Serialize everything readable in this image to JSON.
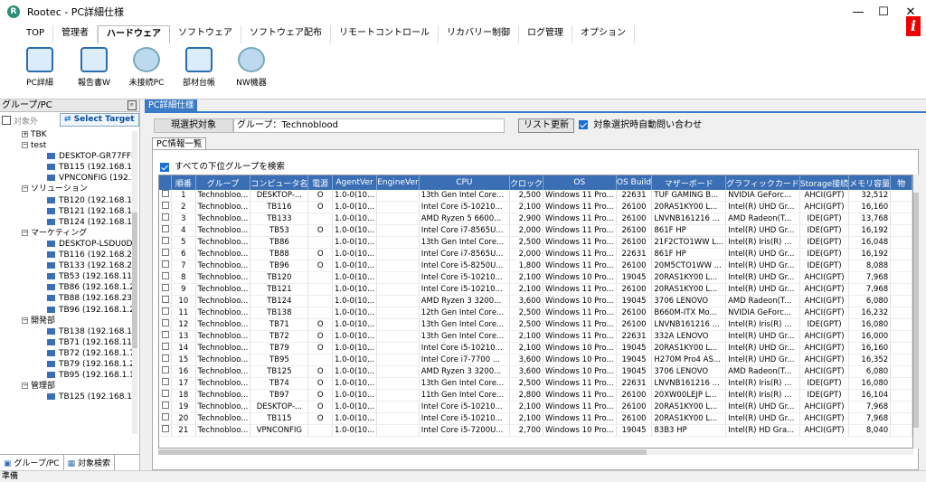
{
  "window": {
    "title": "Rootec - PC詳細仕様",
    "app_icon_letter": "R"
  },
  "menu_tabs": [
    "TOP",
    "管理者",
    "ハードウェア",
    "ソフトウェア",
    "ソフトウェア配布",
    "リモートコントロール",
    "リカバリー制御",
    "ログ管理",
    "オプション"
  ],
  "ribbon": [
    {
      "label": "PC詳細",
      "icon": "pc-detail-icon"
    },
    {
      "label": "報告書W",
      "icon": "report-icon"
    },
    {
      "label": "未接続PC",
      "icon": "unconnected-pc-icon"
    },
    {
      "label": "部材台帳",
      "icon": "parts-ledger-icon"
    },
    {
      "label": "NW機器",
      "icon": "network-device-icon"
    }
  ],
  "left_panel": {
    "title": "グループ/PC",
    "pin": "ᵖ",
    "exclude_label": "対象外",
    "select_target": "Select Target",
    "tabs": [
      "グループ/PC",
      "対象検索"
    ],
    "tree": [
      {
        "text": "TBK",
        "level": 1,
        "type": "group",
        "expanded": false
      },
      {
        "text": "test",
        "level": 1,
        "type": "group",
        "expanded": true
      },
      {
        "text": "DESKTOP-GR77FFF",
        "level": 2,
        "type": "pc"
      },
      {
        "text": "TB115 (192.168.1.2",
        "level": 2,
        "type": "pc"
      },
      {
        "text": "VPNCONFIG (192.1",
        "level": 2,
        "type": "pc"
      },
      {
        "text": "ソリューション",
        "level": 1,
        "type": "group",
        "expanded": true
      },
      {
        "text": "TB120 (192.168.1.2",
        "level": 2,
        "type": "pc"
      },
      {
        "text": "TB121 (192.168.1.2",
        "level": 2,
        "type": "pc"
      },
      {
        "text": "TB124 (192.168.1.1",
        "level": 2,
        "type": "pc"
      },
      {
        "text": "マーケティング",
        "level": 1,
        "type": "group",
        "expanded": true
      },
      {
        "text": "DESKTOP-LSDU0D",
        "level": 2,
        "type": "pc"
      },
      {
        "text": "TB116 (192.168.230",
        "level": 2,
        "type": "pc"
      },
      {
        "text": "TB133 (192.168.230",
        "level": 2,
        "type": "pc"
      },
      {
        "text": "TB53 (192.168.11.1",
        "level": 2,
        "type": "pc"
      },
      {
        "text": "TB86 (192.168.1.21",
        "level": 2,
        "type": "pc"
      },
      {
        "text": "TB88 (192.168.230.",
        "level": 2,
        "type": "pc"
      },
      {
        "text": "TB96 (192.168.1.21",
        "level": 2,
        "type": "pc"
      },
      {
        "text": "開発部",
        "level": 1,
        "type": "group",
        "expanded": true
      },
      {
        "text": "TB138 (192.168.1.1",
        "level": 2,
        "type": "pc"
      },
      {
        "text": "TB71 (192.168.11.8",
        "level": 2,
        "type": "pc"
      },
      {
        "text": "TB72 (192.168.1.72",
        "level": 2,
        "type": "pc"
      },
      {
        "text": "TB79 (192.168.1.22",
        "level": 2,
        "type": "pc"
      },
      {
        "text": "TB95 (192.168.1.10",
        "level": 2,
        "type": "pc"
      },
      {
        "text": "管理部",
        "level": 1,
        "type": "group",
        "expanded": true
      },
      {
        "text": "TB125 (192.168.1.1",
        "level": 2,
        "type": "pc"
      }
    ]
  },
  "panel_tab": "PC詳細仕様",
  "target": {
    "label": "現選択対象",
    "value": "グループ：Technoblood",
    "refresh_button": "リスト更新",
    "auto_query_label": "対象選択時自動問い合わせ"
  },
  "subtab": "PC情報一覧",
  "subgroup_check_label": "すべての下位グループを検索",
  "status": "準備",
  "table": {
    "columns": [
      "順番",
      "グループ",
      "コンピュータ名",
      "電源",
      "AgentVer",
      "EngineVer",
      "CPU",
      "クロック",
      "OS",
      "OS Build",
      "マザーボード",
      "グラフィックカード",
      "Storage接続",
      "メモリ容量",
      "物"
    ],
    "rows": [
      [
        "1",
        "Technobloo...",
        "DESKTOP-...",
        "O",
        "1.0-0(10...",
        "",
        "13th Gen Intel Core...",
        "2,500",
        "Windows 11 Pro...",
        "22631",
        "TUF GAMING B...",
        "NVIDIA GeForc...",
        "AHCI(GPT)",
        "32,512"
      ],
      [
        "2",
        "Technobloo...",
        "TB116",
        "O",
        "1.0-0(10...",
        "",
        "Intel Core i5-10210...",
        "2,100",
        "Windows 11 Pro...",
        "26100",
        "20RAS1KY00 L...",
        "Intel(R) UHD Gr...",
        "AHCI(GPT)",
        "16,160"
      ],
      [
        "3",
        "Technobloo...",
        "TB133",
        "",
        "1.0-0(10...",
        "",
        "AMD Ryzen 5 6600...",
        "2,900",
        "Windows 11 Pro...",
        "26100",
        "LNVNB161216 ...",
        "AMD Radeon(T...",
        "IDE(GPT)",
        "13,768"
      ],
      [
        "4",
        "Technobloo...",
        "TB53",
        "O",
        "1.0-0(10...",
        "",
        "Intel Core i7-8565U...",
        "2,000",
        "Windows 11 Pro...",
        "26100",
        "861F HP",
        "Intel(R) UHD Gr...",
        "IDE(GPT)",
        "16,192"
      ],
      [
        "5",
        "Technobloo...",
        "TB86",
        "",
        "1.0-0(10...",
        "",
        "13th Gen Intel Core...",
        "2,500",
        "Windows 11 Pro...",
        "26100",
        "21F2CTO1WW L...",
        "Intel(R) Iris(R) ...",
        "IDE(GPT)",
        "16,048"
      ],
      [
        "6",
        "Technobloo...",
        "TB88",
        "O",
        "1.0-0(10...",
        "",
        "Intel Core i7-8565U...",
        "2,000",
        "Windows 11 Pro...",
        "22631",
        "861F HP",
        "Intel(R) UHD Gr...",
        "IDE(GPT)",
        "16,192"
      ],
      [
        "7",
        "Technobloo...",
        "TB96",
        "O",
        "1.0-0(10...",
        "",
        "Intel Core i5-8250U...",
        "1,800",
        "Windows 11 Pro...",
        "26100",
        "20M5CTO1WW ...",
        "Intel(R) UHD Gr...",
        "IDE(GPT)",
        "8,088"
      ],
      [
        "8",
        "Technobloo...",
        "TB120",
        "",
        "1.0-0(10...",
        "",
        "Intel Core i5-10210...",
        "2,100",
        "Windows 10 Pro...",
        "19045",
        "20RAS1KY00 L...",
        "Intel(R) UHD Gr...",
        "AHCI(GPT)",
        "7,968"
      ],
      [
        "9",
        "Technobloo...",
        "TB121",
        "",
        "1.0-0(10...",
        "",
        "Intel Core i5-10210...",
        "2,100",
        "Windows 11 Pro...",
        "26100",
        "20RAS1KY00 L...",
        "Intel(R) UHD Gr...",
        "AHCI(GPT)",
        "7,968"
      ],
      [
        "10",
        "Technobloo...",
        "TB124",
        "",
        "1.0-0(10...",
        "",
        "AMD Ryzen 3 3200...",
        "3,600",
        "Windows 10 Pro...",
        "19045",
        "3706 LENOVO",
        "AMD Radeon(T...",
        "AHCI(GPT)",
        "6,080"
      ],
      [
        "11",
        "Technobloo...",
        "TB138",
        "",
        "1.0-0(10...",
        "",
        "12th Gen Intel Core...",
        "2,500",
        "Windows 11 Pro...",
        "26100",
        "B660M-ITX Mo...",
        "NVIDIA GeForc...",
        "AHCI(GPT)",
        "16,232"
      ],
      [
        "12",
        "Technobloo...",
        "TB71",
        "O",
        "1.0-0(10...",
        "",
        "13th Gen Intel Core...",
        "2,500",
        "Windows 11 Pro...",
        "26100",
        "LNVNB161216 ...",
        "Intel(R) Iris(R) ...",
        "IDE(GPT)",
        "16,080"
      ],
      [
        "13",
        "Technobloo...",
        "TB72",
        "O",
        "1.0-0(10...",
        "",
        "13th Gen Intel Core...",
        "2,100",
        "Windows 11 Pro...",
        "22631",
        "332A LENOVO",
        "Intel(R) UHD Gr...",
        "AHCI(GPT)",
        "16,000"
      ],
      [
        "14",
        "Technobloo...",
        "TB79",
        "O",
        "1.0-0(10...",
        "",
        "Intel Core i5-10210...",
        "2,100",
        "Windows 10 Pro...",
        "19045",
        "20RAS1KY00 L...",
        "Intel(R) UHD Gr...",
        "AHCI(GPT)",
        "16,160"
      ],
      [
        "15",
        "Technobloo...",
        "TB95",
        "",
        "1.0-0(10...",
        "",
        "Intel Core i7-7700 ...",
        "3,600",
        "Windows 10 Pro...",
        "19045",
        "H270M Pro4 AS...",
        "Intel(R) UHD Gr...",
        "AHCI(GPT)",
        "16,352"
      ],
      [
        "16",
        "Technobloo...",
        "TB125",
        "O",
        "1.0-0(10...",
        "",
        "AMD Ryzen 3 3200...",
        "3,600",
        "Windows 10 Pro...",
        "19045",
        "3706 LENOVO",
        "AMD Radeon(T...",
        "AHCI(GPT)",
        "6,080"
      ],
      [
        "17",
        "Technobloo...",
        "TB74",
        "O",
        "1.0-0(10...",
        "",
        "13th Gen Intel Core...",
        "2,500",
        "Windows 11 Pro...",
        "22631",
        "LNVNB161216 ...",
        "Intel(R) Iris(R) ...",
        "IDE(GPT)",
        "16,080"
      ],
      [
        "18",
        "Technobloo...",
        "TB97",
        "O",
        "1.0-0(10...",
        "",
        "11th Gen Intel Core...",
        "2,800",
        "Windows 11 Pro...",
        "26100",
        "20XW00LEJP L...",
        "Intel(R) Iris(R) ...",
        "IDE(GPT)",
        "16,104"
      ],
      [
        "19",
        "Technobloo...",
        "DESKTOP-...",
        "O",
        "1.0-0(10...",
        "",
        "Intel Core i5-10210...",
        "2,100",
        "Windows 11 Pro...",
        "26100",
        "20RAS1KY00 L...",
        "Intel(R) UHD Gr...",
        "AHCI(GPT)",
        "7,968"
      ],
      [
        "20",
        "Technobloo...",
        "TB115",
        "O",
        "1.0-0(10...",
        "",
        "Intel Core i5-10210...",
        "2,100",
        "Windows 11 Pro...",
        "26100",
        "20RAS1KY00 L...",
        "Intel(R) UHD Gr...",
        "AHCI(GPT)",
        "7,968"
      ],
      [
        "21",
        "Technobloo...",
        "VPNCONFIG",
        "",
        "1.0-0(10...",
        "",
        "Intel Core i5-7200U...",
        "2,700",
        "Windows 10 Pro...",
        "19045",
        "83B3 HP",
        "Intel(R) HD Gra...",
        "AHCI(GPT)",
        "8,040"
      ]
    ]
  },
  "colors": {
    "accent": "#3a7cc8",
    "header_bg": "#3a6fb5",
    "info_red": "#e00000"
  }
}
